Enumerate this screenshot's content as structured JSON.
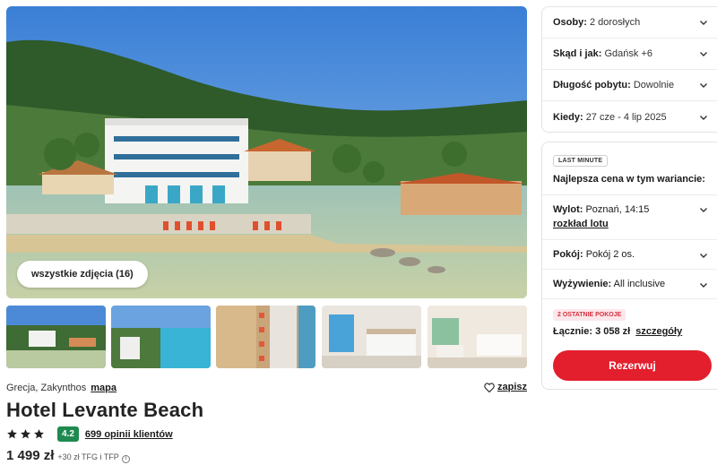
{
  "gallery": {
    "all_photos_label": "wszystkie zdjęcia (16)",
    "thumbnails": [
      "thumbnail-resort-aerial",
      "thumbnail-coast-view",
      "thumbnail-pool-aerial",
      "thumbnail-bedroom-sea-view",
      "thumbnail-bedroom-twin"
    ]
  },
  "hotel": {
    "location": "Grecja, Zakynthos",
    "map_link": "mapa",
    "save_label": "zapisz",
    "name": "Hotel Levante Beach",
    "stars": 3,
    "rating_score": "4.2",
    "reviews_link": "699 opinii klientów",
    "price": "1 499 zł",
    "price_extra": "+30 zł TFG i TFP",
    "rating_color": "#1e8a4f"
  },
  "search": {
    "guests": {
      "label": "Osoby:",
      "value": "2 dorosłych"
    },
    "departure": {
      "label": "Skąd i jak:",
      "value": "Gdańsk +6"
    },
    "duration": {
      "label": "Długość pobytu:",
      "value": "Dowolnie"
    },
    "dates": {
      "label": "Kiedy:",
      "value": "27 cze - 4 lip 2025"
    }
  },
  "offer": {
    "badge": "LAST MINUTE",
    "best_price_text": "Najlepsza cena w tym wariancie:",
    "flight": {
      "label": "Wylot:",
      "value": "Poznań, 14:15",
      "link": "rozkład lotu"
    },
    "room": {
      "label": "Pokój:",
      "value": "Pokój 2 os."
    },
    "board": {
      "label": "Wyżywienie:",
      "value": "All inclusive"
    },
    "rooms_left_badge": "2 OSTATNIE POKOJE",
    "total_text": "Łącznie: 3 058 zł",
    "details_link": "szczegóły",
    "book_button": "Rezerwuj",
    "accent_color": "#e31e2d"
  }
}
